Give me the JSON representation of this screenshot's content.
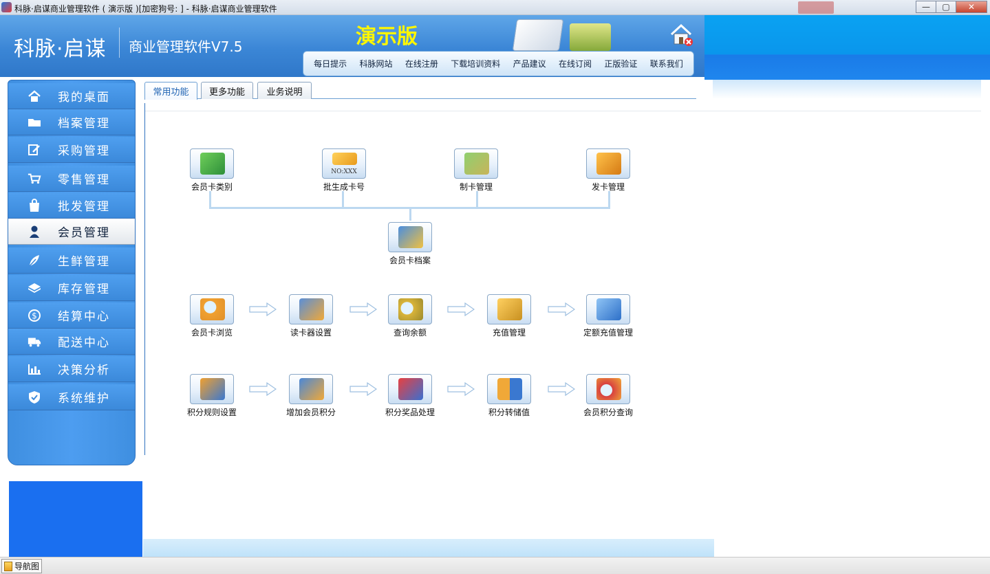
{
  "window": {
    "title": "科脉·启谋商业管理软件 ( 演示版 )[加密狗号: ] - 科脉·启谋商业管理软件",
    "buttons": {
      "minimize": "—",
      "maximize": "▢",
      "close": "✕"
    }
  },
  "header": {
    "brand": "科脉·启谋",
    "subtitle": "商业管理软件V7.5",
    "demo_label": "演示版",
    "nav": [
      "每日提示",
      "科脉网站",
      "在线注册",
      "下载培训资料",
      "产品建议",
      "在线订阅",
      "正版验证",
      "联系我们"
    ]
  },
  "sidebar": {
    "items": [
      {
        "label": "我的桌面",
        "icon": "home-icon"
      },
      {
        "label": "档案管理",
        "icon": "folder-icon"
      },
      {
        "label": "采购管理",
        "icon": "edit-icon"
      },
      {
        "label": "零售管理",
        "icon": "cart-icon"
      },
      {
        "label": "批发管理",
        "icon": "bag-icon"
      },
      {
        "label": "会员管理",
        "icon": "user-icon",
        "active": true
      },
      {
        "label": "生鲜管理",
        "icon": "leaf-icon"
      },
      {
        "label": "库存管理",
        "icon": "box-icon"
      },
      {
        "label": "结算中心",
        "icon": "dollar-icon"
      },
      {
        "label": "配送中心",
        "icon": "truck-icon"
      },
      {
        "label": "决策分析",
        "icon": "barchart-icon"
      },
      {
        "label": "系统维护",
        "icon": "shield-icon"
      }
    ]
  },
  "tabs": [
    "常用功能",
    "更多功能",
    "业务说明"
  ],
  "functions": {
    "row1": [
      "会员卡类别",
      "批生成卡号",
      "制卡管理",
      "发卡管理"
    ],
    "center": "会员卡档案",
    "row2": [
      "会员卡浏览",
      "读卡器设置",
      "查询余额",
      "充值管理",
      "定额充值管理"
    ],
    "row3": [
      "积分规则设置",
      "增加会员积分",
      "积分奖品处理",
      "积分转储值",
      "会员积分查询"
    ],
    "card_text": "NO:XXX"
  },
  "statusbar": {
    "nav_label": "导航图"
  },
  "colors": {
    "header": "#3b86d6",
    "demo": "#fff600",
    "active_tab": "#1f63b3"
  }
}
